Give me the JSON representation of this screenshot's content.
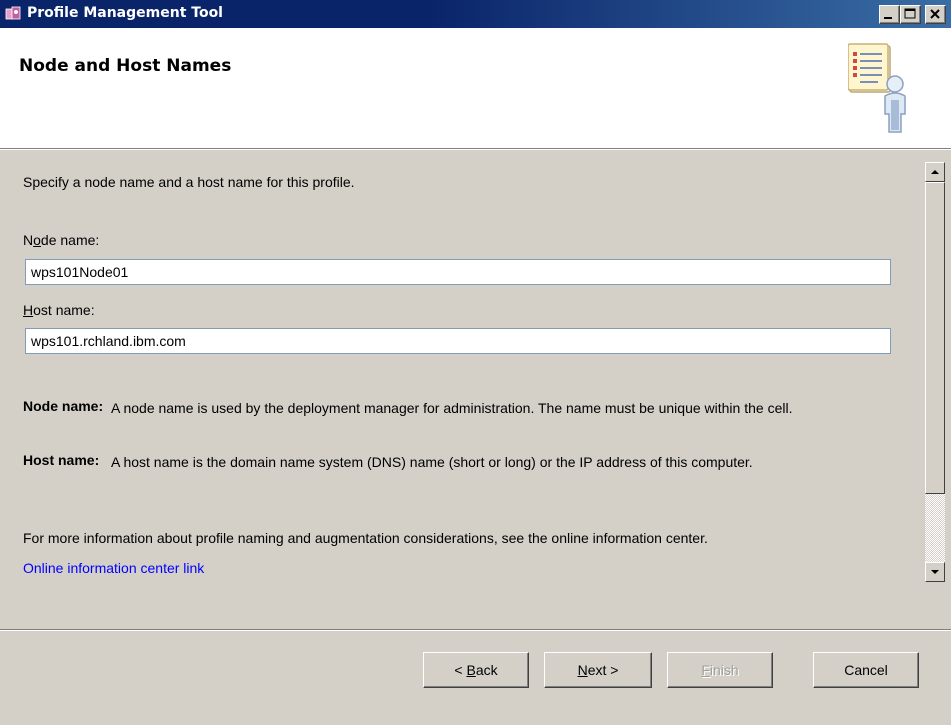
{
  "window": {
    "title": "Profile Management Tool"
  },
  "header": {
    "title": "Node and Host Names"
  },
  "content": {
    "intro": "Specify a node name and a host name for this profile.",
    "node_label": "Node name:",
    "node_value": "wps101Node01",
    "host_label": "Host name:",
    "host_value": "wps101.rchland.ibm.com",
    "desc_node_key": "Node name:",
    "desc_node_text": "A node name is used by the deployment manager for administration. The name must be unique within the cell.",
    "desc_host_key": "Host name:",
    "desc_host_text": "A host name is the domain name system (DNS) name (short or long) or the IP address of this computer.",
    "more_info": "For more information about profile naming and augmentation considerations, see the online information center.",
    "link": "Online information center link"
  },
  "buttons": {
    "back": "< Back",
    "next": "Next >",
    "finish": "Finish",
    "cancel": "Cancel"
  },
  "colors": {
    "titlebar": "#0a246a",
    "face": "#d4d0c8",
    "link": "#0000ff"
  }
}
